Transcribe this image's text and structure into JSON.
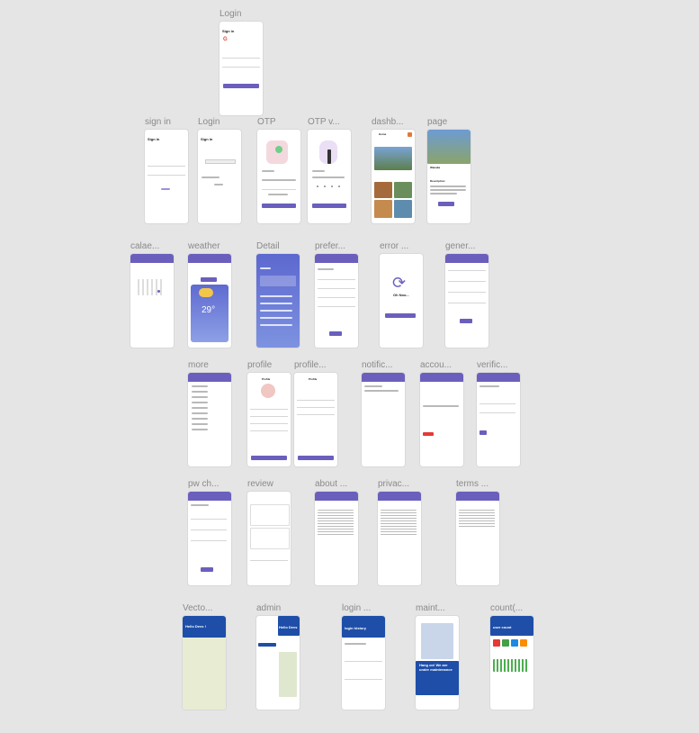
{
  "frames": [
    {
      "id": "login-top",
      "label": "Login",
      "heading": "Sign in",
      "button": "Sign in"
    },
    {
      "id": "sign-in",
      "label": "sign in",
      "heading": "Sign In"
    },
    {
      "id": "login-2",
      "label": "Login",
      "heading": "Sign In"
    },
    {
      "id": "otp",
      "label": "OTP"
    },
    {
      "id": "otp-v",
      "label": "OTP v..."
    },
    {
      "id": "dashb",
      "label": "dashb...",
      "heading": "Home"
    },
    {
      "id": "page",
      "label": "page",
      "heading": "Wanaka",
      "sub": "Description"
    },
    {
      "id": "calae",
      "label": "calae..."
    },
    {
      "id": "weather",
      "label": "weather",
      "temp": "29°"
    },
    {
      "id": "detail",
      "label": "Detail"
    },
    {
      "id": "prefer",
      "label": "prefer..."
    },
    {
      "id": "error",
      "label": "error ...",
      "heading": "Oh Noo..."
    },
    {
      "id": "gener",
      "label": "gener..."
    },
    {
      "id": "more",
      "label": "more"
    },
    {
      "id": "profile",
      "label": "profile",
      "heading": "Profile"
    },
    {
      "id": "profile-2",
      "label": "profile...",
      "heading": "Profile"
    },
    {
      "id": "notific",
      "label": "notific..."
    },
    {
      "id": "accou",
      "label": "accou..."
    },
    {
      "id": "verific",
      "label": "verific..."
    },
    {
      "id": "pw-ch",
      "label": "pw ch..."
    },
    {
      "id": "review",
      "label": "review"
    },
    {
      "id": "about",
      "label": "about ..."
    },
    {
      "id": "privac",
      "label": "privac..."
    },
    {
      "id": "terms",
      "label": "terms ..."
    },
    {
      "id": "vecto",
      "label": "Vecto...",
      "heading": "Hello Devs !"
    },
    {
      "id": "admin",
      "label": "admin",
      "heading": "Hello Devs"
    },
    {
      "id": "login-hist",
      "label": "login ...",
      "heading": "login history"
    },
    {
      "id": "maint",
      "label": "maint...",
      "heading": "Hang on! We are under maintenance"
    },
    {
      "id": "count",
      "label": "count(...",
      "heading": "user count"
    }
  ],
  "colors": {
    "canvas": "#e5e5e5",
    "accent": "#6b5fbd",
    "navy": "#1e4ea8"
  }
}
